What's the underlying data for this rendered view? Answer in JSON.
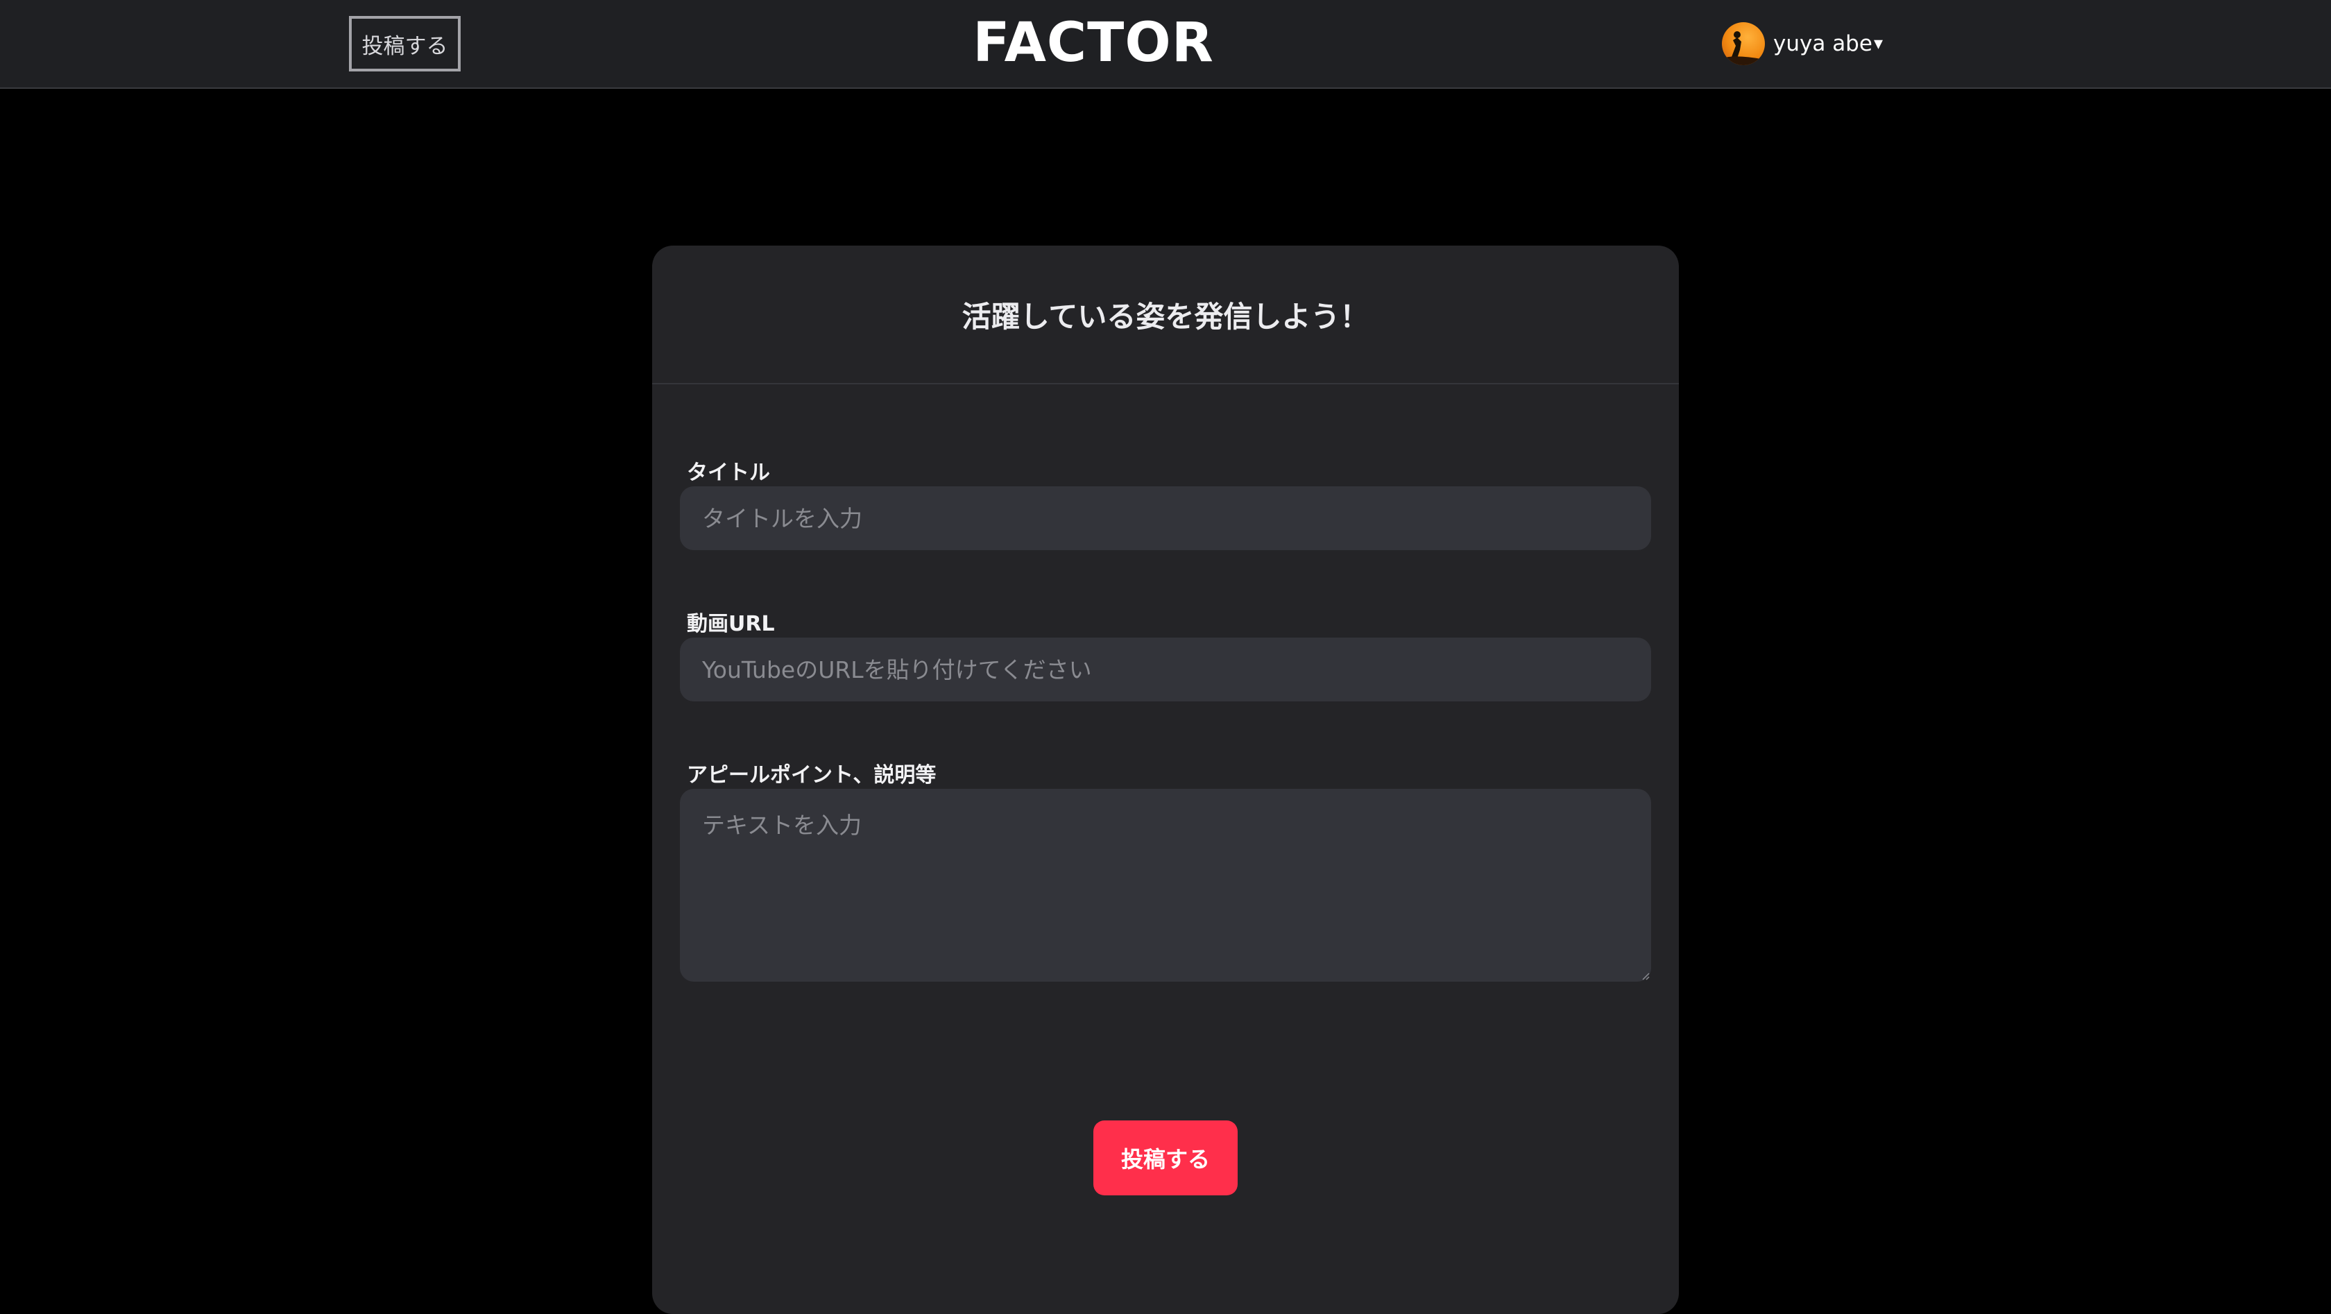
{
  "header": {
    "post_link_label": "投稿する",
    "logo_text": "FACTOR",
    "user_name": "yuya abe",
    "dropdown_caret": "▾"
  },
  "form": {
    "title": "活躍している姿を発信しよう！",
    "fields": {
      "title": {
        "label": "タイトル",
        "placeholder": "タイトルを入力"
      },
      "video_url": {
        "label": "動画URL",
        "placeholder": "YouTubeのURLを貼り付けてください"
      },
      "description": {
        "label": "アピールポイント、説明等",
        "placeholder": "テキストを入力"
      }
    },
    "submit_label": "投稿する"
  },
  "colors": {
    "page_background": "#000000",
    "header_background": "#1f2023",
    "card_background": "#242427",
    "input_background": "#33343a",
    "submit_accent": "#ff2f4b",
    "avatar_accent": "#f28a12"
  }
}
